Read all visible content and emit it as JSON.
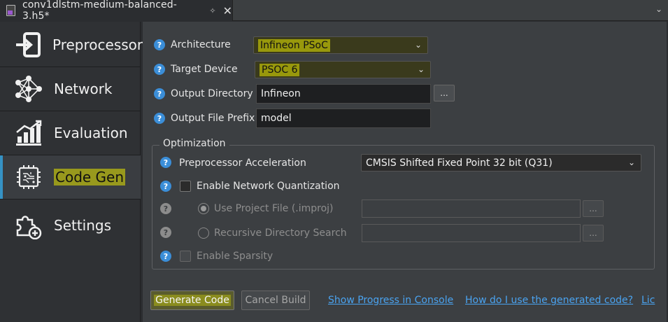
{
  "tab": {
    "title": "conv1dlstm-medium-balanced-3.h5*",
    "pin_glyph": "✧",
    "close_glyph": "✕",
    "overflow_glyph": "⌄"
  },
  "sidebar": {
    "items": [
      {
        "label": "Preprocessor",
        "icon": "arrow-into-box-icon"
      },
      {
        "label": "Network",
        "icon": "network-graph-icon"
      },
      {
        "label": "Evaluation",
        "icon": "bar-chart-icon"
      },
      {
        "label": "Code Gen",
        "icon": "chip-icon",
        "active": true
      },
      {
        "label": "Settings",
        "icon": "puzzle-plus-icon"
      }
    ]
  },
  "form": {
    "architecture_label": "Architecture",
    "architecture_value": "Infineon PSoC",
    "target_device_label": "Target Device",
    "target_device_value": "PSOC 6",
    "output_dir_label": "Output Directory",
    "output_dir_value": "Infineon",
    "output_prefix_label": "Output File Prefix",
    "output_prefix_value": "model",
    "browse_label": "...",
    "help_glyph": "?",
    "chevron_glyph": "⌄"
  },
  "optimization": {
    "title": "Optimization",
    "preproc_accel_label": "Preprocessor Acceleration",
    "preproc_accel_value": "CMSIS Shifted Fixed Point 32 bit (Q31)",
    "enable_quant_label": "Enable Network Quantization",
    "use_project_file_label": "Use Project File (.improj)",
    "recursive_search_label": "Recursive Directory Search",
    "enable_sparsity_label": "Enable Sparsity"
  },
  "actions": {
    "generate_label": "Generate Code",
    "cancel_label": "Cancel Build",
    "show_progress_link": "Show Progress in Console",
    "how_to_link": "How do I use the generated code?",
    "license_link": "Lic"
  },
  "colors": {
    "accent": "#3592c4",
    "link": "#4aa3f0",
    "highlight": "#e6e600"
  }
}
